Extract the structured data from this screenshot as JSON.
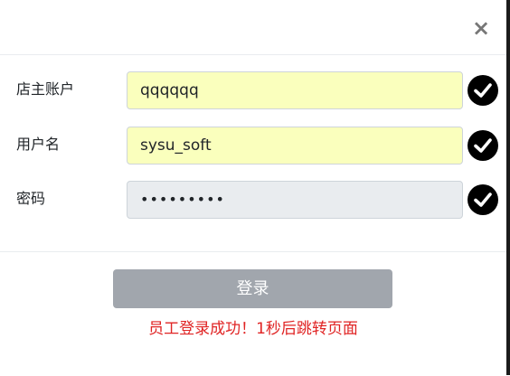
{
  "dialog": {
    "close_symbol": "×"
  },
  "form": {
    "store_account": {
      "label": "店主账户",
      "value": "qqqqqq"
    },
    "username": {
      "label": "用户名",
      "value": "sysu_soft"
    },
    "password": {
      "label": "密码",
      "value": "•••••••••"
    }
  },
  "actions": {
    "login_label": "登录"
  },
  "status": {
    "message": "员工登录成功！1秒后跳转页面",
    "color": "#e02424"
  },
  "icons": {
    "valid": "check-circle-icon",
    "close": "close-icon"
  },
  "colors": {
    "autofill_bg": "#faffbd",
    "disabled_bg": "#e9ecef",
    "button_bg": "#a1a6ad"
  }
}
